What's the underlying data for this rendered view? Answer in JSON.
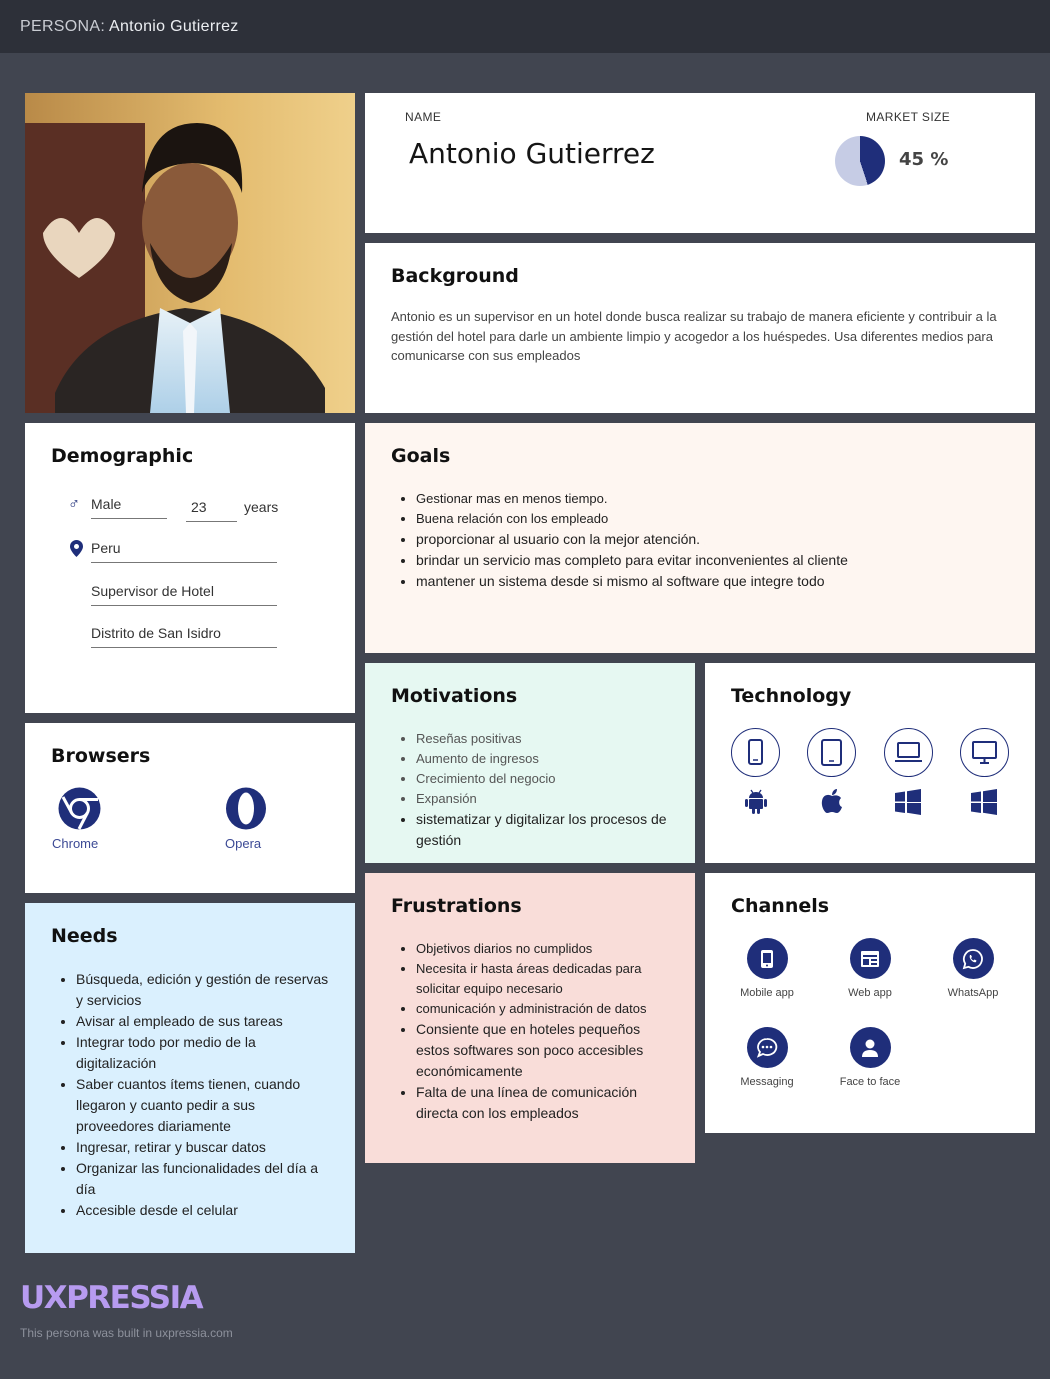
{
  "header": {
    "prefix": "PERSONA:",
    "name": "Antonio Gutierrez"
  },
  "profile": {
    "name_label": "NAME",
    "name": "Antonio Gutierrez",
    "market_label": "MARKET SIZE",
    "market_value": 45,
    "market_text": "45 %"
  },
  "background": {
    "title": "Background",
    "text": "Antonio es un supervisor en un hotel donde busca realizar su trabajo de manera eficiente y contribuir a la gestión del hotel para darle un ambiente limpio y acogedor a los huéspedes. Usa diferentes medios para comunicarse con sus empleados"
  },
  "demographic": {
    "title": "Demographic",
    "gender": "Male",
    "age": "23",
    "age_unit": "years",
    "location": "Peru",
    "occupation": "Supervisor de Hotel",
    "district": "Distrito de San Isidro"
  },
  "goals": {
    "title": "Goals",
    "items": [
      "Gestionar mas en menos tiempo.",
      "Buena relación con los empleado",
      "proporcionar al usuario con la mejor atención.",
      " brindar un servicio mas completo para evitar inconvenientes al cliente",
      " mantener un sistema desde si mismo al software que integre todo"
    ]
  },
  "motivations": {
    "title": "Motivations",
    "items": [
      "Reseñas positivas",
      "Aumento de ingresos",
      "Crecimiento del negocio",
      "Expansión",
      "sistematizar y digitalizar los procesos de gestión"
    ]
  },
  "technology": {
    "title": "Technology",
    "devices": [
      "mobile-phone-icon",
      "tablet-icon",
      "laptop-icon",
      "desktop-monitor-icon"
    ],
    "platforms": [
      "android-icon",
      "apple-icon",
      "windows-icon",
      "windows-icon"
    ]
  },
  "browsers": {
    "title": "Browsers",
    "items": [
      {
        "label": "Chrome",
        "icon": "chrome-icon"
      },
      {
        "label": "Opera",
        "icon": "opera-icon"
      }
    ]
  },
  "needs": {
    "title": "Needs",
    "items": [
      "Búsqueda, edición y gestión de reservas y servicios",
      "Avisar al empleado de sus tareas",
      " Integrar todo por medio de la digitalización",
      " Saber cuantos ítems tienen, cuando llegaron y cuanto pedir a sus proveedores diariamente",
      " Ingresar, retirar y buscar  datos",
      " Organizar las funcionalidades del día a día",
      " Accesible desde el celular"
    ]
  },
  "frustrations": {
    "title": "Frustrations",
    "items": [
      "Objetivos diarios no cumplidos",
      "Necesita ir hasta áreas dedicadas  para solicitar equipo necesario",
      " comunicación y administración de datos",
      "Consiente que  en hoteles pequeños estos softwares son poco accesibles económicamente",
      "Falta de una línea de comunicación directa con los empleados"
    ]
  },
  "channels": {
    "title": "Channels",
    "items": [
      "Mobile app",
      "Web app",
      "WhatsApp",
      "Messaging",
      "Face to face"
    ]
  },
  "footer": {
    "logo": "UXPRESSIA",
    "built": "This persona was built in uxpressia.com"
  },
  "colors": {
    "background": "#414550",
    "topbar": "#2d3039",
    "accent": "#1f2e7a",
    "goals_bg": "#fef6f1",
    "motivations_bg": "#e6f8f2",
    "needs_bg": "#daf0fe",
    "frustrations_bg": "#f9ddd9",
    "logo": "#b79bf0"
  }
}
